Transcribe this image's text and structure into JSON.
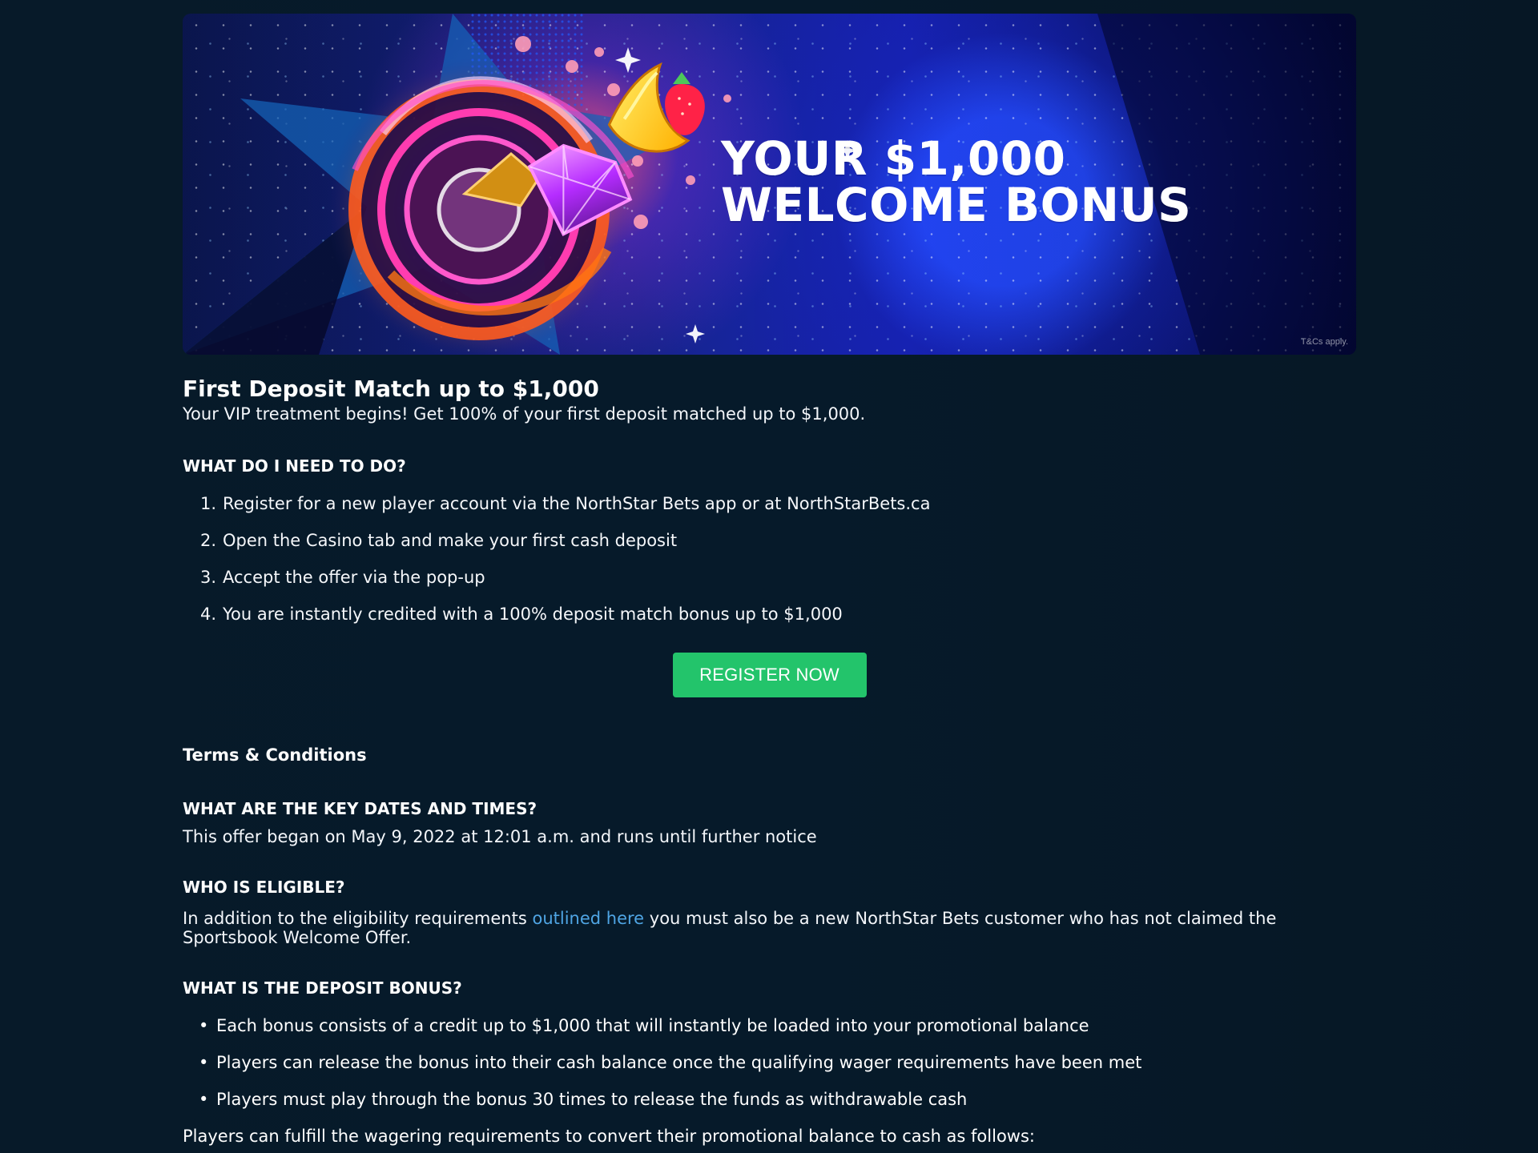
{
  "banner": {
    "title": "YOUR $1,000\nWELCOME BONUS",
    "tcs": "T&Cs apply."
  },
  "offer": {
    "title": "First Deposit Match up to $1,000",
    "intro": "Your VIP treatment begins! Get 100% of your first deposit matched up to $1,000."
  },
  "steps": {
    "heading": "WHAT DO I NEED TO DO?",
    "items": [
      {
        "number": "1.",
        "text": "Register for a new player account via the NorthStar Bets app or at NorthStarBets.ca"
      },
      {
        "number": "2.",
        "text": "Open the Casino tab and make your first cash deposit"
      },
      {
        "number": "3.",
        "text": "Accept the offer via the pop-up"
      },
      {
        "number": "4.",
        "text": "You are instantly credited with a 100% deposit match bonus up to $1,000"
      }
    ]
  },
  "cta": {
    "label": "REGISTER NOW"
  },
  "terms": {
    "title": "Terms & Conditions",
    "dates_heading": "WHAT ARE THE KEY DATES AND TIMES?",
    "dates_text": "This offer began on May 9, 2022 at 12:01 a.m. and runs until further notice",
    "eligible_heading": "WHO IS ELIGIBLE?",
    "eligible_before": "In addition to the eligibility requirements ",
    "eligible_link": "outlined here",
    "eligible_after": " you must also be a new NorthStar Bets customer who has not claimed the Sportsbook Welcome Offer.",
    "bonus_heading": "WHAT IS THE DEPOSIT BONUS?",
    "bonus_items": [
      "Each bonus consists of a credit up to $1,000 that will instantly be loaded into your promotional balance",
      "Players can release the bonus into their cash balance once the qualifying wager requirements have been met",
      "Players must play through the bonus 30 times to release the funds as withdrawable cash"
    ],
    "wagering_text": "Players can fulfill the wagering requirements to convert their promotional balance to cash as follows:"
  },
  "colors": {
    "background": "#061a2a",
    "button": "#23c46b",
    "link": "#4fa5e4"
  }
}
